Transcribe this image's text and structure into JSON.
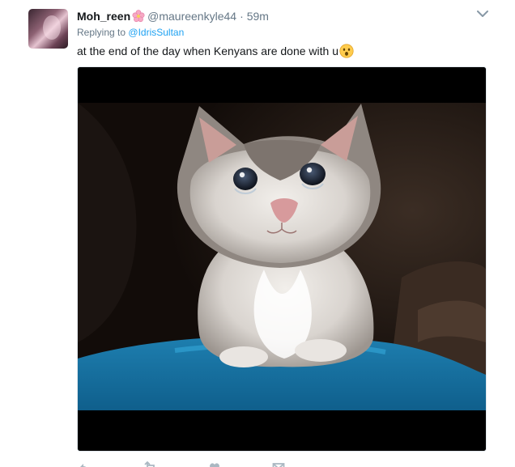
{
  "tweet": {
    "display_name": "Moh_reen",
    "name_emoji": "cherry-blossom-icon",
    "handle": "@maureenkyle44",
    "separator": "·",
    "time": "59m",
    "reply_prefix": "Replying to",
    "reply_to": "@IdrisSultan",
    "text": "at the end of the day when Kenyans are done with u",
    "text_emoji": "hushed-face-icon",
    "media": {
      "description_icon": "crying-kitten-photo"
    },
    "actions": [
      "reply-icon",
      "retweet-icon",
      "like-icon",
      "dm-icon"
    ]
  },
  "colors": {
    "link": "#1da1f2",
    "secondary_text": "#657786",
    "primary_text": "#14171a"
  }
}
